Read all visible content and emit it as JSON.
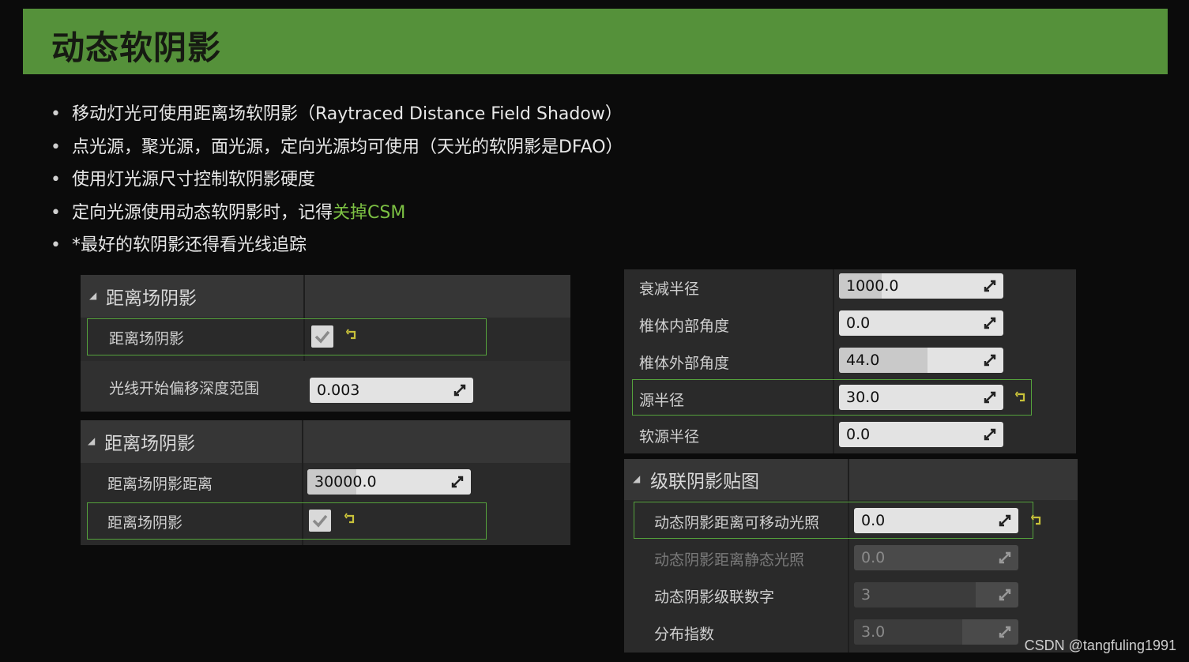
{
  "slide": {
    "title": "动态软阴影",
    "bullets": [
      {
        "prefix": "移动灯光可使用距离场软阴影（Raytraced Distance Field Shadow）",
        "highlight": "",
        "suffix": ""
      },
      {
        "prefix": "点光源，聚光源，面光源，定向光源均可使用（天光的软阴影是DFAO）",
        "highlight": "",
        "suffix": ""
      },
      {
        "prefix": "使用灯光源尺寸控制软阴影硬度",
        "highlight": "",
        "suffix": ""
      },
      {
        "prefix": "定向光源使用动态软阴影时，记得",
        "highlight": "关掉CSM",
        "suffix": ""
      },
      {
        "prefix": "*最好的软阴影还得看光线追踪",
        "highlight": "",
        "suffix": ""
      }
    ],
    "bullet_char": "•",
    "highlight_color": "#7cc043",
    "title_bar_color": "#55913a"
  },
  "panel_a": {
    "section": "距离场阴影",
    "rows": [
      {
        "label": "距离场阴影",
        "type": "checkbox",
        "checked": true
      },
      {
        "label": "光线开始偏移深度范围",
        "type": "number",
        "value": "0.003",
        "fill": 0.0
      }
    ]
  },
  "panel_b": {
    "section": "距离场阴影",
    "rows": [
      {
        "label": "距离场阴影距离",
        "type": "number",
        "value": "30000.0",
        "fill": 0.3
      },
      {
        "label": "距离场阴影",
        "type": "checkbox",
        "checked": true
      }
    ]
  },
  "panel_c": {
    "rows": [
      {
        "label": "衰减半径",
        "type": "number",
        "value": "1000.0",
        "fill": 0.26
      },
      {
        "label": "椎体内部角度",
        "type": "number",
        "value": "0.0",
        "fill": 0.0
      },
      {
        "label": "椎体外部角度",
        "type": "number",
        "value": "44.0",
        "fill": 0.54
      },
      {
        "label": "源半径",
        "type": "number",
        "value": "30.0",
        "fill": 0.0
      },
      {
        "label": "软源半径",
        "type": "number",
        "value": "0.0",
        "fill": 0.0
      }
    ]
  },
  "panel_d": {
    "section": "级联阴影贴图",
    "rows": [
      {
        "label": "动态阴影距离可移动光照",
        "type": "number",
        "value": "0.0",
        "enabled": true
      },
      {
        "label": "动态阴影距离静态光照",
        "type": "number",
        "value": "0.0",
        "enabled": false
      },
      {
        "label": "动态阴影级联数字",
        "type": "number",
        "value": "3",
        "enabled": false
      },
      {
        "label": "分布指数",
        "type": "number",
        "value": "3.0",
        "enabled": false
      }
    ]
  },
  "icons": {
    "expand": "triangle-down-icon",
    "spinner": "drag-arrows-icon",
    "reset": "reset-to-default-icon",
    "check": "checkmark-icon"
  },
  "watermark": "CSDN @tangfuling1991"
}
